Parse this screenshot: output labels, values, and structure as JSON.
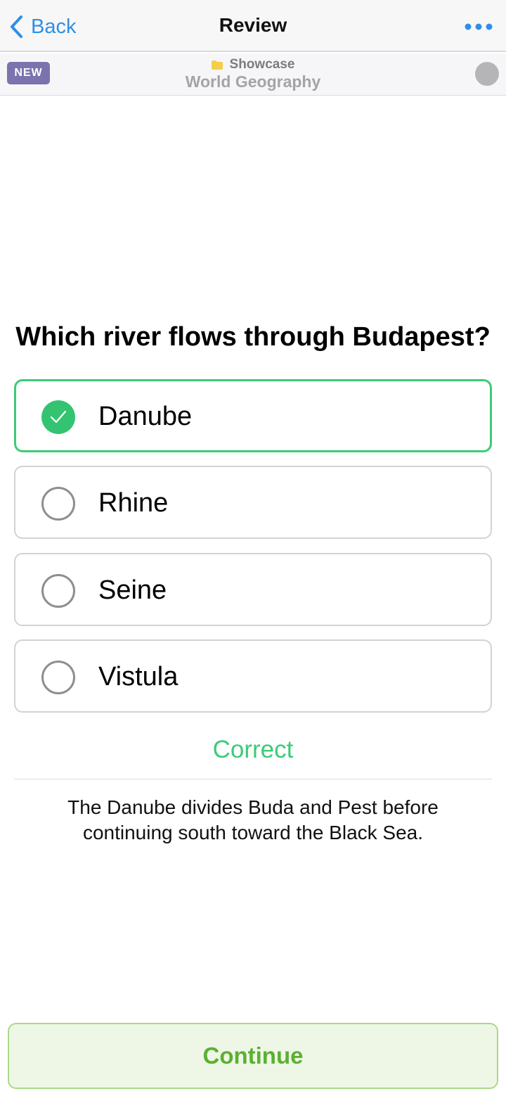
{
  "nav": {
    "back_label": "Back",
    "title": "Review",
    "more_icon": "more-horizontal-icon"
  },
  "deck": {
    "badge": "NEW",
    "folder_icon": "folder-icon",
    "folder": "Showcase",
    "name": "World Geography"
  },
  "quiz": {
    "question": "Which river flows through Budapest?",
    "options": [
      {
        "label": "Danube",
        "state": "correct"
      },
      {
        "label": "Rhine",
        "state": "unselected"
      },
      {
        "label": "Seine",
        "state": "unselected"
      },
      {
        "label": "Vistula",
        "state": "unselected"
      }
    ],
    "result": "Correct",
    "explanation": "The Danube divides Buda and Pest before continuing south toward the Black Sea."
  },
  "footer": {
    "continue_label": "Continue"
  },
  "colors": {
    "accent_blue": "#2f8fe6",
    "correct_green": "#3dcb78",
    "badge_purple": "#7a73ad",
    "continue_text": "#5bb032"
  }
}
